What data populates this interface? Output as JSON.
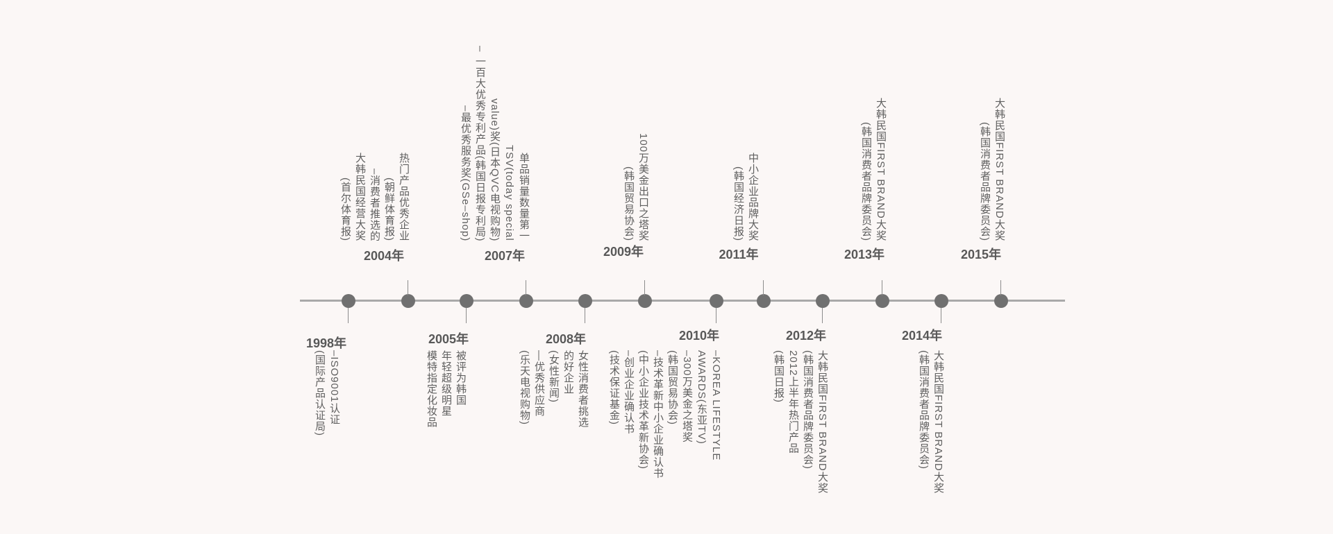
{
  "timeline": {
    "milestones": [
      {
        "year": "1998年",
        "position": "below",
        "lines": [
          "–ISO9001认证",
          "(国际产品认证局)"
        ]
      },
      {
        "year": "2004年",
        "position": "above",
        "lines": [
          "热门产品优秀企业",
          "(朝鲜体育报)",
          "–消费者推选的",
          "大韩民国经营大奖",
          "(首尔体育报)"
        ]
      },
      {
        "year": "2005年",
        "position": "below",
        "lines": [
          "被评为韩国",
          "年轻超级明星",
          "模特指定化妆品"
        ]
      },
      {
        "year": "2007年",
        "position": "above",
        "lines": [
          "单品销量数量第一",
          "TSV(today special",
          "value)奖(日本QVC电视购物)",
          "– 一百大优秀专利产品(韩国日报专利局)",
          "–最优秀服务奖(GSe–shop)"
        ]
      },
      {
        "year": "2008年",
        "position": "below",
        "lines": [
          "女性消费者挑选",
          "的好企业",
          "(女性新闻)",
          "—优秀供应商",
          "(乐天电视购物)"
        ]
      },
      {
        "year": "2009年",
        "position": "above",
        "lines": [
          "100万美金出口之塔奖",
          "(韩国贸易协会)"
        ]
      },
      {
        "year": "2010年",
        "position": "below",
        "lines": [
          "–KOREA LIFESTYLE",
          "AWARDS(东亚TV)",
          "–300万美金之塔奖",
          "(韩国贸易协会)",
          "–技术革新中小企业确认书",
          "(中小企业技术革新协会)",
          "–创业企业确认书",
          "(技术保证基金)"
        ]
      },
      {
        "year": "2011年",
        "position": "above",
        "lines": [
          "中小企业品牌大奖",
          "(韩国经济日报)"
        ]
      },
      {
        "year": "2012年",
        "position": "below",
        "lines": [
          "大韩民国FIRST BRAND大奖",
          "(韩国消费者品牌委员会)",
          "2012上半年热门产品",
          "(韩国日报)"
        ]
      },
      {
        "year": "2013年",
        "position": "above",
        "lines": [
          "大韩民国FIRST BRAND大奖",
          "(韩国消费者品牌委员会)"
        ]
      },
      {
        "year": "2014年",
        "position": "below",
        "lines": [
          "大韩民国FIRST BRAND大奖",
          "(韩国消费者品牌委员会)"
        ]
      },
      {
        "year": "2015年",
        "position": "above",
        "lines": [
          "大韩民国FIRST BRAND大奖",
          "(韩国消费者品牌委员会)"
        ]
      }
    ]
  }
}
